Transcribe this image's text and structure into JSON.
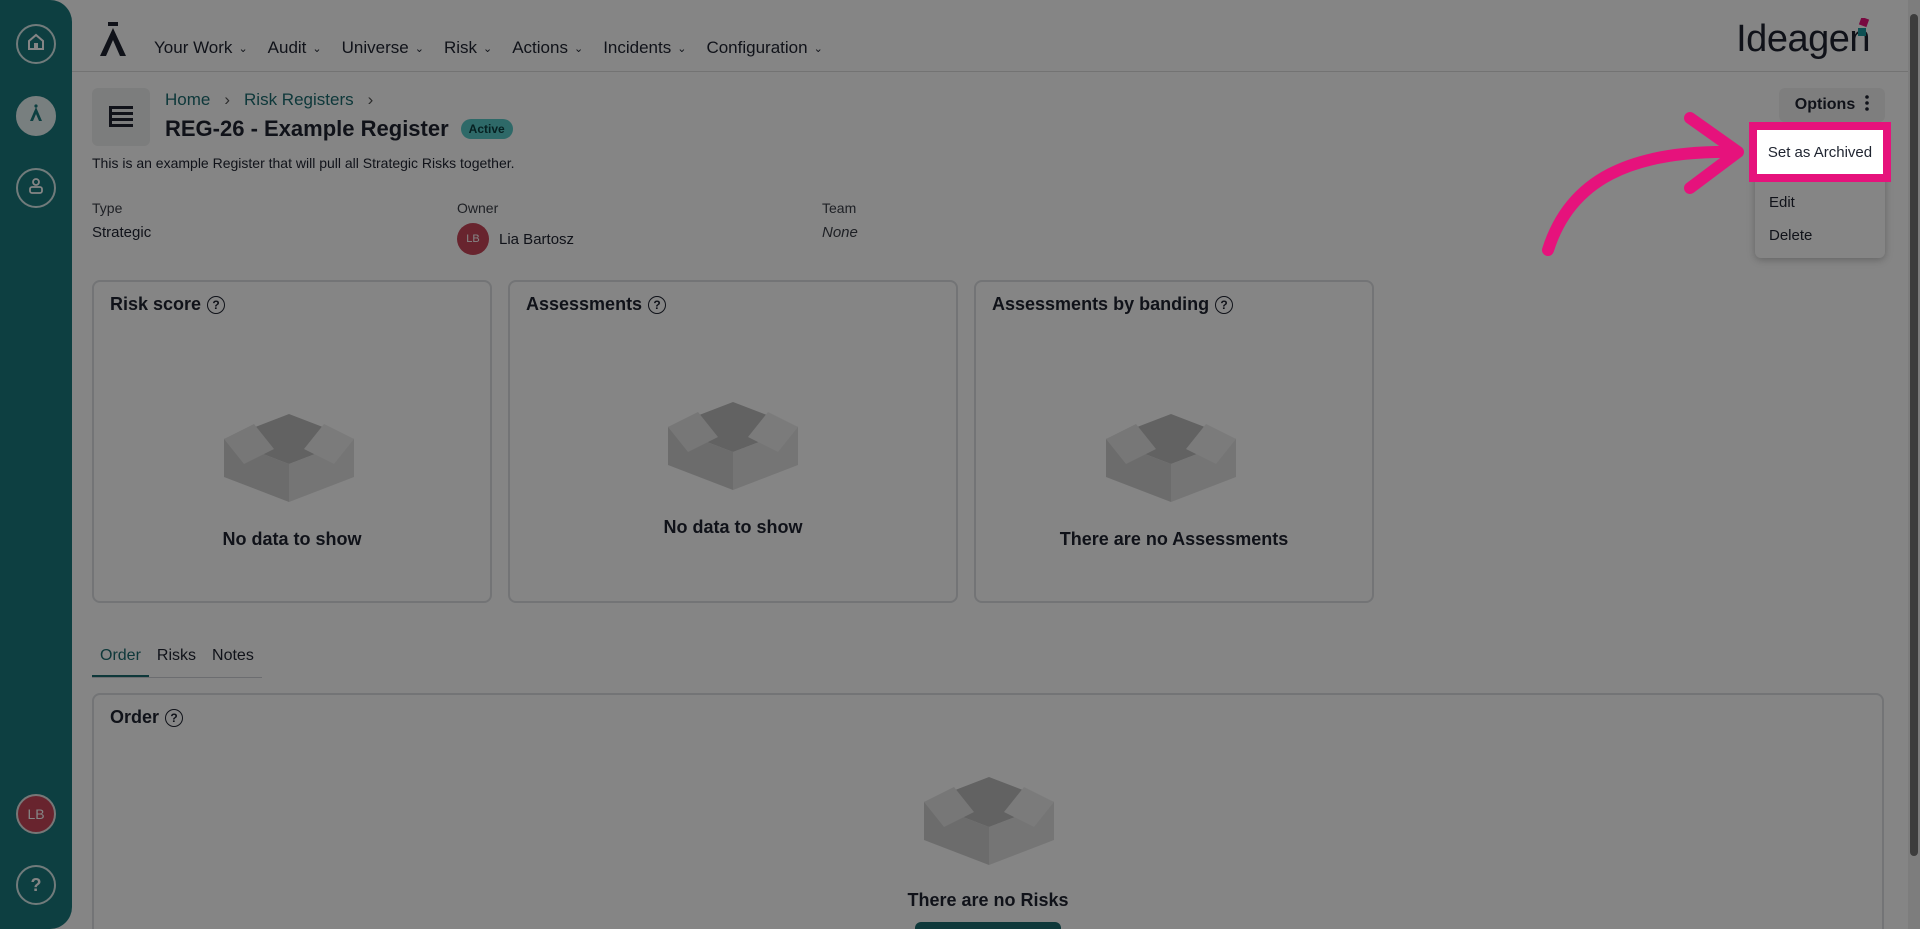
{
  "sidebar": {
    "avatar_initials": "LB",
    "help_label": "?"
  },
  "nav": {
    "items": [
      "Your Work",
      "Audit",
      "Universe",
      "Risk",
      "Actions",
      "Incidents",
      "Configuration"
    ],
    "brand": "Ideagen"
  },
  "breadcrumb": {
    "home": "Home",
    "risk_registers": "Risk Registers",
    "sep1": "›",
    "sep2": "›"
  },
  "register": {
    "title": "REG-26 - Example Register",
    "status": "Active",
    "description": "This is an example Register that will pull all Strategic Risks together."
  },
  "meta": {
    "type_label": "Type",
    "type_value": "Strategic",
    "owner_label": "Owner",
    "owner_initials": "LB",
    "owner_name": "Lia Bartosz",
    "team_label": "Team",
    "team_value": "None"
  },
  "options": {
    "label": "Options",
    "menu": [
      "Set as Archived",
      "Edit",
      "Delete"
    ]
  },
  "cards": [
    {
      "title": "Risk score",
      "message": "No data to show"
    },
    {
      "title": "Assessments",
      "message": "No data to show"
    },
    {
      "title": "Assessments by banding",
      "message": "There are no Assessments"
    }
  ],
  "tabs": [
    "Order",
    "Risks",
    "Notes"
  ],
  "order": {
    "title": "Order",
    "message": "There are no Risks"
  },
  "colors": {
    "accent": "#1b6c70",
    "highlight": "#e6127c",
    "sidebar": "#1a7a7e"
  }
}
